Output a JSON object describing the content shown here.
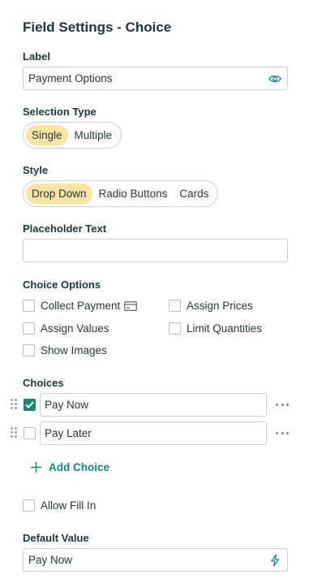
{
  "header": {
    "title": "Field Settings - Choice"
  },
  "label_section": {
    "heading": "Label",
    "value": "Payment Options",
    "icon": "eye-icon"
  },
  "selection_type": {
    "heading": "Selection Type",
    "options": [
      "Single",
      "Multiple"
    ],
    "selected": "Single"
  },
  "style": {
    "heading": "Style",
    "options": [
      "Drop Down",
      "Radio Buttons",
      "Cards"
    ],
    "selected": "Drop Down"
  },
  "placeholder": {
    "heading": "Placeholder Text",
    "value": ""
  },
  "choice_options": {
    "heading": "Choice Options",
    "items": [
      {
        "label": "Collect Payment",
        "checked": false,
        "icon": "card-icon"
      },
      {
        "label": "Assign Prices",
        "checked": false
      },
      {
        "label": "Assign Values",
        "checked": false
      },
      {
        "label": "Limit Quantities",
        "checked": false
      },
      {
        "label": "Show Images",
        "checked": false
      }
    ]
  },
  "choices": {
    "heading": "Choices",
    "items": [
      {
        "label": "Pay Now",
        "checked": true
      },
      {
        "label": "Pay Later",
        "checked": false
      }
    ],
    "add_label": "Add Choice"
  },
  "allow_fill_in": {
    "label": "Allow Fill In",
    "checked": false
  },
  "default_value": {
    "heading": "Default Value",
    "value": "Pay Now",
    "icon": "lightning-icon"
  },
  "colors": {
    "accent": "#0e8a7d",
    "selected_segment": "#fbe3a3",
    "border": "#c9cfd1"
  }
}
